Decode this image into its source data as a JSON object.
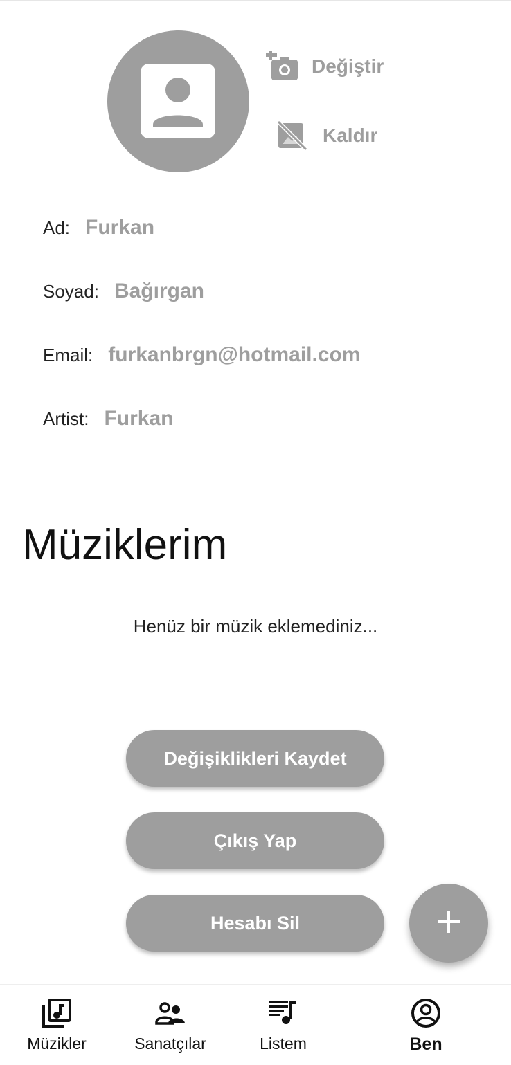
{
  "profile": {
    "avatar_icon": "account-box-icon",
    "change_photo_label": "Değiştir",
    "remove_photo_label": "Kaldır",
    "fields": [
      {
        "label": "Ad:",
        "value": "Furkan"
      },
      {
        "label": "Soyad:",
        "value": "Bağırgan"
      },
      {
        "label": "Email:",
        "value": "furkanbrgn@hotmail.com"
      },
      {
        "label": "Artist:",
        "value": "Furkan"
      }
    ]
  },
  "music": {
    "title": "Müziklerim",
    "empty_message": "Henüz bir müzik eklemediniz..."
  },
  "actions": {
    "save_label": "Değişiklikleri Kaydet",
    "logout_label": "Çıkış Yap",
    "delete_label": "Hesabı Sil"
  },
  "nav": {
    "items": [
      {
        "label": "Müzikler",
        "icon": "music-library-icon"
      },
      {
        "label": "Sanatçılar",
        "icon": "people-icon"
      },
      {
        "label": "Listem",
        "icon": "playlist-icon"
      },
      {
        "label": "Ben",
        "icon": "account-circle-icon"
      }
    ],
    "active_index": 3
  },
  "colors": {
    "accent_gray": "#9e9e9e",
    "text_dark": "#222222",
    "background": "#ffffff"
  }
}
